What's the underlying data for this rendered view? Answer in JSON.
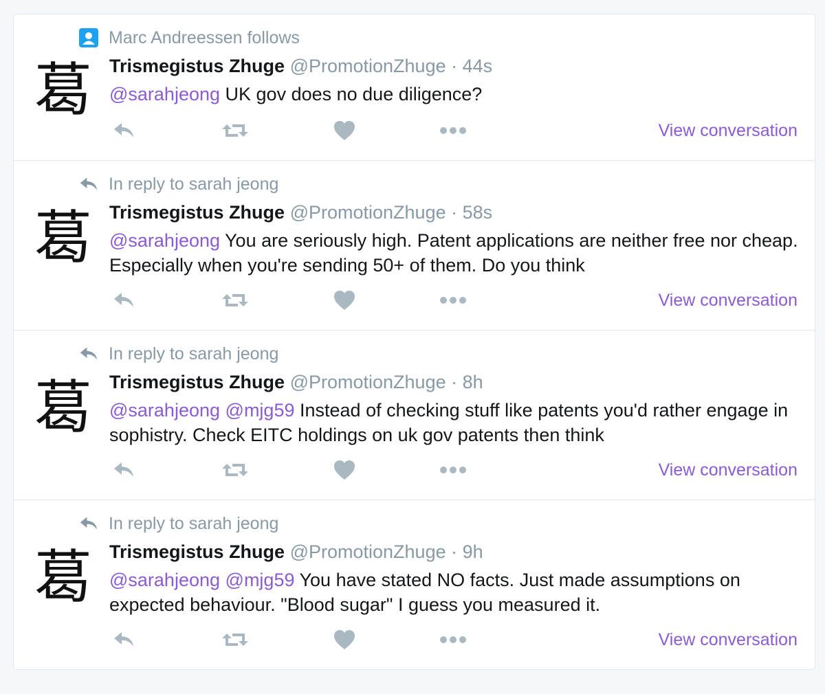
{
  "tweets": [
    {
      "context": "Marc Andreessen follows",
      "context_icon": "person-icon",
      "avatar_char": "葛",
      "fullname": "Trismegistus Zhuge",
      "handle": "@PromotionZhuge",
      "sep": " · ",
      "time": "44s",
      "mentions": [
        "@sarahjeong"
      ],
      "text": "UK gov does no due diligence?",
      "view_conversation": "View conversation"
    },
    {
      "context": "In reply to sarah jeong",
      "context_icon": "reply-icon",
      "avatar_char": "葛",
      "fullname": "Trismegistus Zhuge",
      "handle": "@PromotionZhuge",
      "sep": " · ",
      "time": "58s",
      "mentions": [
        "@sarahjeong"
      ],
      "text": "You are seriously high. Patent applications are neither free nor cheap. Especially when you're sending 50+ of them. Do you think",
      "view_conversation": "View conversation"
    },
    {
      "context": "In reply to sarah jeong",
      "context_icon": "reply-icon",
      "avatar_char": "葛",
      "fullname": "Trismegistus Zhuge",
      "handle": "@PromotionZhuge",
      "sep": " · ",
      "time": "8h",
      "mentions": [
        "@sarahjeong",
        "@mjg59"
      ],
      "text": "Instead of checking stuff like patents you'd rather engage in sophistry. Check EITC holdings on uk gov patents then think",
      "view_conversation": "View conversation"
    },
    {
      "context": "In reply to sarah jeong",
      "context_icon": "reply-icon",
      "avatar_char": "葛",
      "fullname": "Trismegistus Zhuge",
      "handle": "@PromotionZhuge",
      "sep": " · ",
      "time": "9h",
      "mentions": [
        "@sarahjeong",
        "@mjg59"
      ],
      "text": "You have stated NO facts. Just made assumptions on expected behaviour. \"Blood sugar\" I guess you measured it.",
      "view_conversation": "View conversation"
    }
  ],
  "colors": {
    "accent": "#8b5bd3",
    "muted": "#8899a6",
    "icon": "#aab8c2",
    "badge": "#1da1f2",
    "text": "#14171a"
  }
}
